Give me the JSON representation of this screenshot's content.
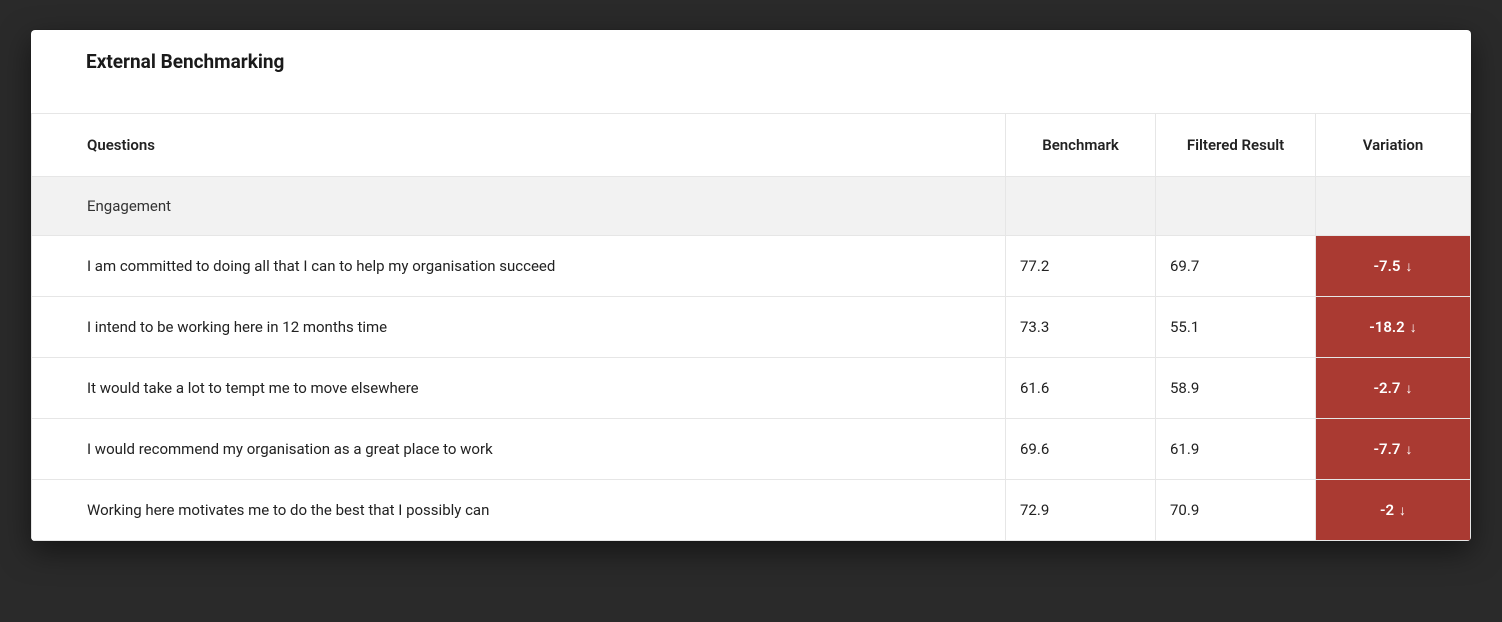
{
  "title": "External Benchmarking",
  "columns": {
    "questions": "Questions",
    "benchmark": "Benchmark",
    "filtered": "Filtered Result",
    "variation": "Variation"
  },
  "category": "Engagement",
  "rows": [
    {
      "question": "I am committed to doing all that I can to help my organisation succeed",
      "benchmark": "77.2",
      "filtered": "69.7",
      "variation": "-7.5",
      "direction": "down"
    },
    {
      "question": "I intend to be working here in 12 months time",
      "benchmark": "73.3",
      "filtered": "55.1",
      "variation": "-18.2",
      "direction": "down"
    },
    {
      "question": "It would take a lot to tempt me to move elsewhere",
      "benchmark": "61.6",
      "filtered": "58.9",
      "variation": "-2.7",
      "direction": "down"
    },
    {
      "question": "I would recommend my organisation as a great place to work",
      "benchmark": "69.6",
      "filtered": "61.9",
      "variation": "-7.7",
      "direction": "down"
    },
    {
      "question": "Working here motivates me to do the best that I possibly can",
      "benchmark": "72.9",
      "filtered": "70.9",
      "variation": "-2",
      "direction": "down"
    }
  ],
  "colors": {
    "negative": "#aa3a32"
  }
}
